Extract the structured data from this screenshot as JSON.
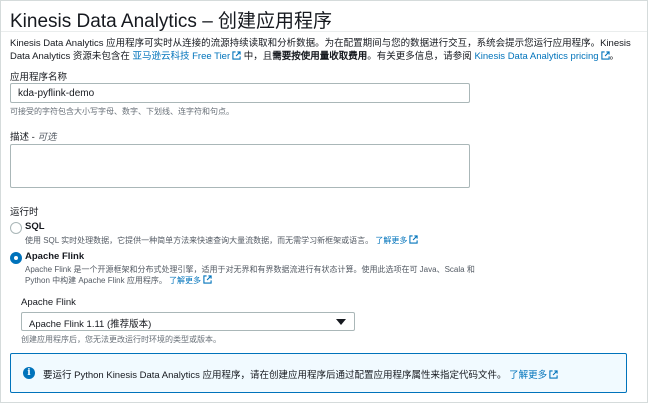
{
  "page": {
    "title": "Kinesis Data Analytics – 创建应用程序",
    "intro_part1": "Kinesis Data Analytics 应用程序可实时从连接的流源持续读取和分析数据。为在配置期间与您的数据进行交互，系统会提示您运行应用程序。Kinesis Data Analytics 资源未包含在 ",
    "intro_link1": "亚马逊云科技 Free Tier",
    "intro_part2": " 中，且",
    "intro_bold": "需要按使用量收取费用",
    "intro_part3": "。有关更多信息，请参阅 ",
    "intro_link2": "Kinesis Data Analytics pricing",
    "intro_end": "。"
  },
  "app_name": {
    "label": "应用程序名称",
    "value": "kda-pyflink-demo",
    "hint": "可接受的字符包含大小写字母、数字、下划线、连字符和句点。"
  },
  "description": {
    "label": "描述",
    "optional": "可选"
  },
  "runtime": {
    "label": "运行时",
    "options": [
      {
        "name": "SQL",
        "selected": false,
        "desc": "使用 SQL 实时处理数据，它提供一种简单方法来快速查询大量流数据，而无需学习新框架或语言。",
        "learn_more": "了解更多"
      },
      {
        "name": "Apache Flink",
        "selected": true,
        "desc_line1": "Apache Flink 是一个开源框架和分布式处理引擎，适用于对无界和有界数据流进行有状态计算。使用此选项在可 Java、Scala 和",
        "desc_line2": "Python 中构建 Apache Flink 应用程序。",
        "learn_more": "了解更多"
      }
    ],
    "version_label": "Apache Flink",
    "version_value": "Apache Flink 1.11 (推荐版本)",
    "version_hint": "创建应用程序后，您无法更改运行时环境的类型或版本。"
  },
  "info": {
    "text": "要运行 Python Kinesis Data Analytics 应用程序，请在创建应用程序后通过配置应用程序属性来指定代码文件。",
    "learn_more": "了解更多"
  },
  "icons": {
    "external": "external-link-icon",
    "info": "info-icon",
    "dropdown": "caret-down-icon"
  },
  "colors": {
    "link": "#0073bb",
    "info_bg": "#f1faff",
    "info_border": "#0073bb"
  }
}
